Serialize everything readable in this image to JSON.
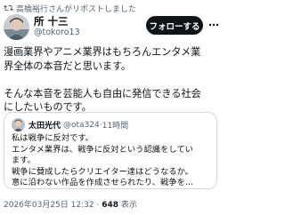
{
  "repost_banner": {
    "text": "高橋裕行さんがリポストしました",
    "icon": "repost-icon"
  },
  "author": {
    "name": "所 十三",
    "handle": "@tokoro13",
    "avatar_icon": "avatar"
  },
  "follow_button": {
    "label": "フォローする"
  },
  "more_icon": "more-dots-icon",
  "post": {
    "lines": [
      "漫画業界やアニメ業界はもちろんエンタメ業",
      "界全体の本音だと思います。",
      "",
      "そんな本音を芸能人も自由に発信できる社会",
      "にしたいものです。"
    ]
  },
  "quote": {
    "name": "太田光代",
    "handle": "@ota324",
    "separator": "·",
    "time": "11時間",
    "lines": [
      "私は戦争に反対です。",
      "エンタメ業界は、戦争に反対という認識をしてい",
      "ます。",
      "戦争に賛成したらクリエイター達はどうなるか。",
      "意に沿わない作品を作成させられたり、戦争を…"
    ]
  },
  "meta": {
    "date": "2026年03月25日 12:32",
    "separator": "·",
    "views_count": "648",
    "views_label": "表示"
  },
  "colors": {
    "text_primary": "#0f1419",
    "text_secondary": "#536471",
    "follow_bg": "#0f1419",
    "border": "#cfd9de"
  }
}
